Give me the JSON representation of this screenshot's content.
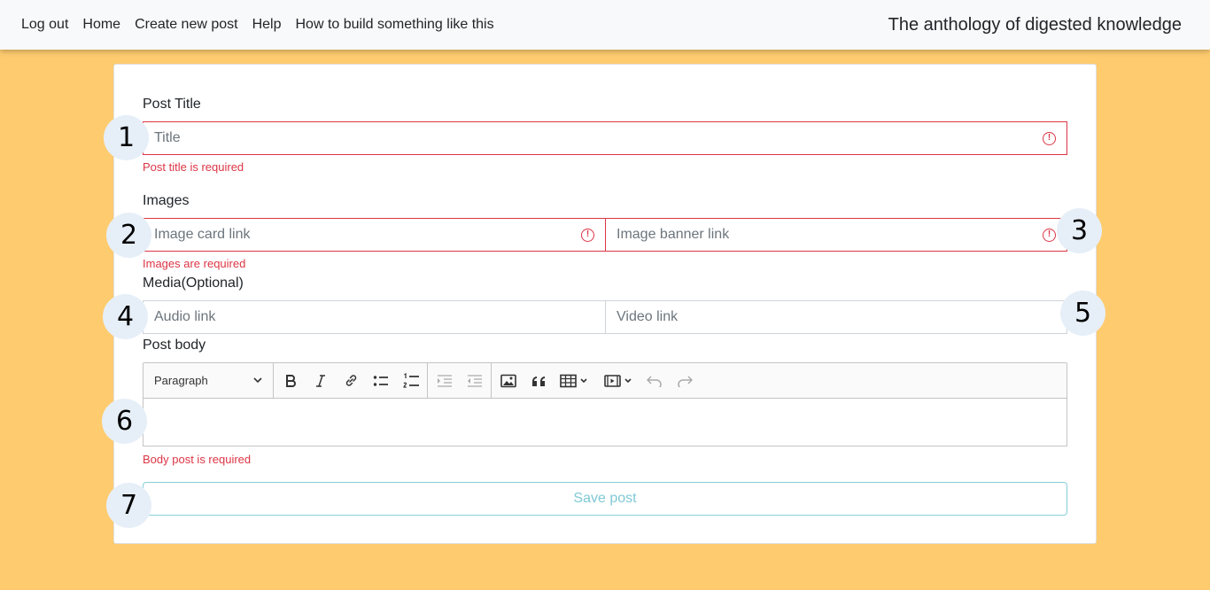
{
  "nav": {
    "links": [
      "Log out",
      "Home",
      "Create new post",
      "Help",
      "How to build something like this"
    ],
    "brand": "The anthology of digested knowledge"
  },
  "form": {
    "title_label": "Post Title",
    "title_placeholder": "Title",
    "title_error": "Post title is required",
    "images_label": "Images",
    "image_card_placeholder": "Image card link",
    "image_banner_placeholder": "Image banner link",
    "images_error": "Images are required",
    "media_label": "Media(Optional)",
    "audio_placeholder": "Audio link",
    "video_placeholder": "Video link",
    "body_label": "Post body",
    "body_error": "Body post is required",
    "save_label": "Save post",
    "error_icon_glyph": "!"
  },
  "editor": {
    "paragraph_label": "Paragraph",
    "tools": [
      "bold-icon",
      "italic-icon",
      "link-icon",
      "bulleted-list-icon",
      "numbered-list-icon",
      "indent-icon",
      "outdent-icon",
      "image-icon",
      "blockquote-icon",
      "table-icon",
      "media-embed-icon",
      "undo-icon",
      "redo-icon"
    ]
  },
  "badges": [
    "1",
    "2",
    "3",
    "4",
    "5",
    "6",
    "7"
  ],
  "colors": {
    "background": "#fecb6e",
    "navbar": "#f8f9fa",
    "error": "#dc3545",
    "save_border": "#86cfda",
    "badge": "#e6eff8"
  }
}
